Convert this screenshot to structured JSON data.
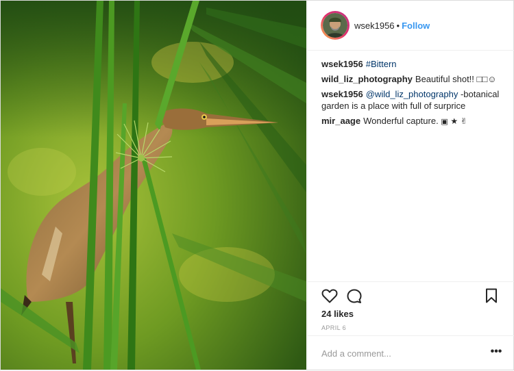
{
  "post": {
    "photo_alt": "",
    "author": "wsek1956",
    "separator": "•",
    "follow_label": "Follow"
  },
  "comments": [
    {
      "user": "wsek1956",
      "text": "",
      "link": "#Bittern",
      "text_after": ""
    },
    {
      "user": "wild_liz_photography",
      "text": "Beautiful shot!! □□",
      "link": "",
      "text_after": ""
    },
    {
      "user": "wsek1956",
      "text": "",
      "link": "@wild_liz_photography",
      "text_after": " -botanical garden is a place with full of surprice"
    },
    {
      "user": "mir_aage",
      "text": "Wonderful capture.",
      "link": "",
      "text_after": ""
    }
  ],
  "actions": {
    "likes": "24 likes",
    "date": "APRIL 6"
  },
  "add_comment": {
    "placeholder": "Add a comment...",
    "more_label": "•••"
  },
  "colors": {
    "accent": "#3897f0",
    "link": "#003569",
    "border": "#efefef"
  },
  "icons": [
    "heart-icon",
    "comment-icon",
    "bookmark-icon",
    "camera-emoji-icon",
    "star-emoji-icon",
    "hand-emoji-icon"
  ]
}
